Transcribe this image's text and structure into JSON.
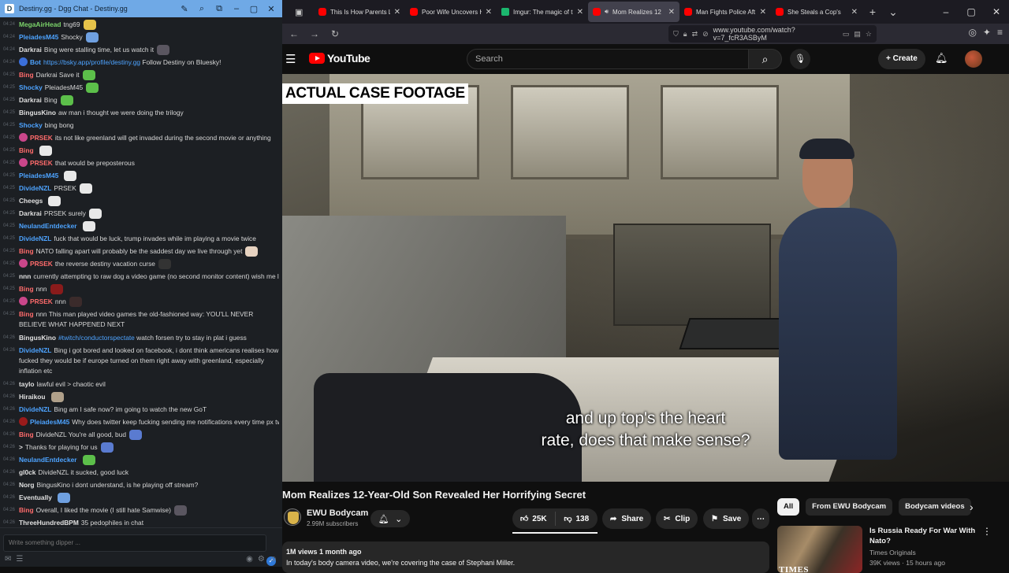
{
  "chat": {
    "window_title": "Destiny.gg - Dgg Chat - Destiny.gg",
    "input_placeholder": "Write something dipper ...",
    "messages": [
      {
        "ts": "04:24",
        "user": "MegaAirHead",
        "user_color": "#7bd36a",
        "text": "tng69",
        "emote": "#e6c34a"
      },
      {
        "ts": "04:24",
        "user": "PleiadesM45",
        "user_color": "#4da3ff",
        "text": "Shocky",
        "emote": "#6fa0e0"
      },
      {
        "ts": "04:24",
        "user": "Darkrai",
        "user_color": "#e0e0e0",
        "text": "Bing were stalling time, let us watch it",
        "emote": "#5a5660"
      },
      {
        "ts": "04:24",
        "user": "Bot",
        "user_color": "#4da3ff",
        "text": "Follow Destiny on Bluesky!",
        "link": "https://bsky.app/profile/destiny.gg",
        "badge": "#3b6fd9"
      },
      {
        "ts": "04:25",
        "user": "Bing",
        "user_color": "#ff6b6b",
        "text": "Darkrai Save it",
        "emote": "#5cbf4a"
      },
      {
        "ts": "04:25",
        "user": "Shocky",
        "user_color": "#4da3ff",
        "text": "PleiadesM45",
        "emote": "#5cbf4a"
      },
      {
        "ts": "04:25",
        "user": "Darkrai",
        "user_color": "#e0e0e0",
        "text": "Bing",
        "emote": "#5cbf4a"
      },
      {
        "ts": "04:25",
        "user": "BingusKino",
        "user_color": "#e0e0e0",
        "text": "aw man i thought we were doing the trilogy"
      },
      {
        "ts": "04:25",
        "user": "Shocky",
        "user_color": "#4da3ff",
        "text": "bing bong"
      },
      {
        "ts": "04:25",
        "user": "PRSEK",
        "user_color": "#ff6b6b",
        "text": "its not like greenland will get invaded during the second movie or anything",
        "badge": "#c9468a"
      },
      {
        "ts": "04:25",
        "user": "Bing",
        "user_color": "#ff6b6b",
        "text": "",
        "emote": "#e8e8e8"
      },
      {
        "ts": "04:25",
        "user": "PRSEK",
        "user_color": "#ff6b6b",
        "text": "that would be preposterous",
        "badge": "#c9468a"
      },
      {
        "ts": "04:25",
        "user": "PleiadesM45",
        "user_color": "#4da3ff",
        "text": "",
        "emote": "#e8e8e8"
      },
      {
        "ts": "04:25",
        "user": "DivideNZL",
        "user_color": "#4da3ff",
        "text": "PRSEK",
        "emote": "#e8e8e8"
      },
      {
        "ts": "04:25",
        "user": "Cheegs",
        "user_color": "#e0e0e0",
        "text": "",
        "emote": "#e8e8e8"
      },
      {
        "ts": "04:25",
        "user": "Darkrai",
        "user_color": "#e0e0e0",
        "text": "PRSEK surely",
        "emote": "#e8e8e8"
      },
      {
        "ts": "04:25",
        "user": "NeulandEntdecker",
        "user_color": "#4da3ff",
        "text": "",
        "emote": "#e8e8e8"
      },
      {
        "ts": "04:25",
        "user": "DivideNZL",
        "user_color": "#4da3ff",
        "text": "fuck that would be luck, trump invades while im playing a movie twice"
      },
      {
        "ts": "04:25",
        "user": "Bing",
        "user_color": "#ff6b6b",
        "text": "NATO falling apart will probably be the saddest day we live through yet",
        "emote": "#e6d2c0"
      },
      {
        "ts": "04:25",
        "user": "PRSEK",
        "user_color": "#ff6b6b",
        "text": "the reverse destiny vacation curse",
        "badge": "#c9468a",
        "emote": "#333"
      },
      {
        "ts": "04:25",
        "user": "nnn",
        "user_color": "#e0e0e0",
        "text": "currently attempting to raw dog a video game (no second monitor content) wish me luck"
      },
      {
        "ts": "04:25",
        "user": "Bing",
        "user_color": "#ff6b6b",
        "text": "nnn",
        "emote": "#8a1b1b"
      },
      {
        "ts": "04:25",
        "user": "PRSEK",
        "user_color": "#ff6b6b",
        "text": "nnn",
        "badge": "#c9468a",
        "emote": "#3b2b2b"
      },
      {
        "ts": "04:25",
        "user": "Bing",
        "user_color": "#ff6b6b",
        "text": "nnn This man played video games the old-fashioned way: YOU'LL NEVER BELIEVE WHAT HAPPENED NEXT",
        "wrap": true
      },
      {
        "ts": "04:26",
        "user": "BingusKino",
        "user_color": "#e0e0e0",
        "text": "watch forsen try to stay in plat i guess",
        "link": "#twitch/conductorspectate"
      },
      {
        "ts": "04:26",
        "user": "DivideNZL",
        "user_color": "#4da3ff",
        "text": "Bing i got bored and looked on facebook, i dont think americans realises how fucked they would be if europe turned on them right away with greenland, especially inflation etc",
        "wrap": true
      },
      {
        "ts": "04:26",
        "user": "taylo",
        "user_color": "#e0e0e0",
        "text": "lawful evil > chaotic evil"
      },
      {
        "ts": "04:26",
        "user": "Hiraikou",
        "user_color": "#e0e0e0",
        "text": "",
        "emote": "#b0a08a"
      },
      {
        "ts": "04:26",
        "user": "DivideNZL",
        "user_color": "#4da3ff",
        "text": "Bing am I safe now? im going to watch the new GoT"
      },
      {
        "ts": "04:26",
        "user": "PleiadesM45",
        "user_color": "#4da3ff",
        "text": "Why does twitter keep fucking sending me notifications every time px tweets",
        "badge": "#9a1b1b"
      },
      {
        "ts": "04:26",
        "user": "Bing",
        "user_color": "#ff6b6b",
        "text": "DivideNZL You're all good, bud",
        "emote": "#5a7bd0"
      },
      {
        "ts": "04:26",
        "user": ">",
        "user_color": "#e0e0e0",
        "text": "Thanks for playing for us",
        "emote": "#5a7bd0"
      },
      {
        "ts": "04:26",
        "user": "NeulandEntdecker",
        "user_color": "#4da3ff",
        "text": "",
        "emote": "#5cbf4a"
      },
      {
        "ts": "04:26",
        "user": "gl0ck",
        "user_color": "#e0e0e0",
        "text": "DivideNZL it sucked, good luck"
      },
      {
        "ts": "04:26",
        "user": "Norg",
        "user_color": "#e0e0e0",
        "text": "BingusKino i dont understand, is he playing off stream?"
      },
      {
        "ts": "04:26",
        "user": "Eventually",
        "user_color": "#e0e0e0",
        "text": "",
        "emote": "#6fa0e0"
      },
      {
        "ts": "04:26",
        "user": "Bing",
        "user_color": "#ff6b6b",
        "text": "Overall, I liked the movie (I still hate Samwise)",
        "emote": "#5a5660"
      },
      {
        "ts": "04:26",
        "user": "ThreeHundredBPM",
        "user_color": "#e0e0e0",
        "text": "35 pedophiles in chat"
      }
    ]
  },
  "browser": {
    "tabs": [
      {
        "title": "This Is How Parents L",
        "icon": "youtube-icon",
        "active": false
      },
      {
        "title": "Poor Wife Uncovers H",
        "icon": "youtube-icon",
        "active": false
      },
      {
        "title": "Imgur: The magic of t",
        "icon": "imgur-icon",
        "active": false
      },
      {
        "title": "Mom Realizes 12",
        "icon": "youtube-icon",
        "active": true
      },
      {
        "title": "Man Fights Police Aft",
        "icon": "youtube-icon",
        "active": false
      },
      {
        "title": "She Steals a Cop's",
        "icon": "youtube-icon",
        "active": false
      }
    ],
    "url": "www.youtube.com/watch?v=7_fcR3ASByM"
  },
  "youtube": {
    "logo_text": "YouTube",
    "search_placeholder": "Search",
    "create_label": "Create",
    "video_banner": "ACTUAL CASE FOOTAGE",
    "subtitle_line1": "and up top's the heart",
    "subtitle_line2": "rate, does that make sense?",
    "video_title": "Mom Realizes 12-Year-Old Son Revealed Her Horrifying Secret",
    "channel_name": "EWU Bodycam",
    "channel_subs": "2.99M subscribers",
    "likes": "25K",
    "dislikes": "138",
    "share_label": "Share",
    "clip_label": "Clip",
    "save_label": "Save",
    "desc_meta": "1M views  1 month ago",
    "desc_text": "In today's body camera video, we're covering the case of Stephani Miller.",
    "chips": [
      "All",
      "From EWU Bodycam",
      "Bodycam videos"
    ],
    "rec": {
      "thumb_tag": "TIMES",
      "title": "Is Russia Ready For War With Nato?",
      "channel": "Times Originals",
      "meta": "39K views · 15 hours ago"
    }
  }
}
